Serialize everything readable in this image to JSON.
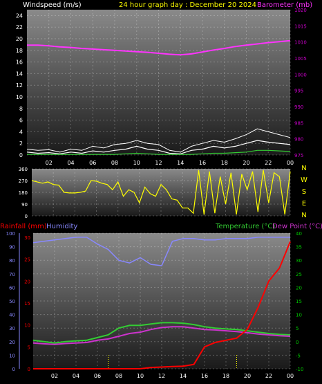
{
  "header": {
    "left_label": "Windspeed (m/s)",
    "center_label": "24 hour graph day : December 20 2024",
    "right_label": "Barometer (mb)"
  },
  "colors": {
    "windspeed": "#ffffff",
    "gust": "#ffffff",
    "avgwind": "#33cc33",
    "barometer": "#ff33ff",
    "direction": "#ffff00",
    "rainfall": "#ff0000",
    "humidity": "#8888ff",
    "temperature": "#33cc33",
    "dewpoint": "#cc33cc",
    "title": "#ffff00",
    "axis_right_top": "#cc00cc",
    "axis_temp": "#00cc00",
    "sunrise": "#ffff00"
  },
  "x_ticks": [
    "02",
    "04",
    "06",
    "08",
    "10",
    "12",
    "14",
    "16",
    "18",
    "20",
    "22",
    "00"
  ],
  "compass": [
    "N",
    "W",
    "S",
    "E",
    "N"
  ],
  "bottom_labels": {
    "rainfall": "Rainfall (mm)",
    "humidity": "Humidity",
    "temperature": "Temperature (°C)",
    "dewpoint": "Dew Point (°C)"
  },
  "chart_data": [
    {
      "type": "line",
      "name": "wind_barometer",
      "x": [
        0,
        1,
        2,
        3,
        4,
        5,
        6,
        7,
        8,
        9,
        10,
        11,
        12,
        13,
        14,
        15,
        16,
        17,
        18,
        19,
        20,
        21,
        22,
        23,
        24
      ],
      "series": [
        {
          "name": "Windspeed (m/s)",
          "axis": "left",
          "values": [
            0.5,
            0.3,
            0.4,
            0.2,
            0.5,
            0.3,
            0.7,
            0.5,
            0.8,
            1.0,
            1.5,
            1.0,
            0.8,
            0.3,
            0.2,
            0.8,
            1.0,
            1.5,
            1.2,
            1.5,
            2.0,
            2.5,
            2.2,
            2.0,
            1.8
          ]
        },
        {
          "name": "Gust",
          "axis": "left",
          "values": [
            1.0,
            0.8,
            0.9,
            0.5,
            1.0,
            0.8,
            1.5,
            1.2,
            1.8,
            2.0,
            2.5,
            2.0,
            1.8,
            0.8,
            0.5,
            1.5,
            2.0,
            2.5,
            2.2,
            2.8,
            3.5,
            4.5,
            4.0,
            3.5,
            3.0
          ]
        },
        {
          "name": "Average",
          "axis": "left",
          "values": [
            0.1,
            0.1,
            0.1,
            0.1,
            0.1,
            0.1,
            0.1,
            0.1,
            0.1,
            0.2,
            0.3,
            0.2,
            0.1,
            0.1,
            0.1,
            0.1,
            0.2,
            0.3,
            0.3,
            0.4,
            0.5,
            0.8,
            0.8,
            0.7,
            0.6
          ]
        },
        {
          "name": "Barometer (mb)",
          "axis": "right",
          "values": [
            1009,
            1009,
            1008.8,
            1008.5,
            1008.3,
            1008,
            1007.8,
            1007.6,
            1007.4,
            1007.2,
            1007,
            1006.8,
            1006.5,
            1006.2,
            1006,
            1006.3,
            1006.9,
            1007.5,
            1008,
            1008.6,
            1009,
            1009.4,
            1009.8,
            1010.1,
            1010.4
          ]
        }
      ],
      "ylim_left": [
        0,
        25
      ],
      "ylim_right": [
        975,
        1020
      ],
      "yticks_left": [
        0,
        2,
        4,
        6,
        8,
        10,
        12,
        14,
        16,
        18,
        20,
        22,
        24
      ],
      "yticks_right": [
        975,
        980,
        985,
        990,
        995,
        1000,
        1005,
        1010,
        1015,
        1020
      ]
    },
    {
      "type": "scatter",
      "name": "wind_direction",
      "x": [
        0,
        0.5,
        1,
        1.5,
        2,
        2.5,
        3,
        3.5,
        4,
        4.5,
        5,
        5.5,
        6,
        6.5,
        7,
        7.5,
        8,
        8.5,
        9,
        9.5,
        10,
        10.5,
        11,
        11.5,
        12,
        12.5,
        13,
        13.5,
        14,
        14.5,
        15,
        15.5,
        16,
        16.5,
        17,
        17.5,
        18,
        18.5,
        19,
        19.5,
        20,
        20.5,
        21,
        21.5,
        22,
        22.5,
        23,
        23.5,
        24
      ],
      "values": [
        270,
        260,
        250,
        260,
        240,
        235,
        180,
        175,
        175,
        180,
        190,
        270,
        265,
        250,
        240,
        200,
        260,
        150,
        200,
        180,
        100,
        220,
        170,
        150,
        240,
        200,
        130,
        120,
        60,
        60,
        20,
        350,
        10,
        340,
        20,
        300,
        90,
        330,
        10,
        320,
        200,
        340,
        30,
        350,
        100,
        330,
        300,
        10,
        340
      ],
      "ylim": [
        0,
        360
      ],
      "yticks": [
        0,
        90,
        180,
        270,
        360
      ]
    },
    {
      "type": "line",
      "name": "rain_humidity_temp",
      "x": [
        0,
        1,
        2,
        3,
        4,
        5,
        6,
        7,
        8,
        9,
        10,
        11,
        12,
        13,
        14,
        15,
        16,
        17,
        18,
        19,
        20,
        21,
        22,
        23,
        24
      ],
      "series": [
        {
          "name": "Rainfall (mm)",
          "axis": "left",
          "values": [
            0,
            0,
            0,
            0,
            0,
            0,
            0,
            0,
            0,
            0,
            0,
            0.3,
            0.4,
            0.5,
            0.6,
            1.0,
            5.0,
            6.0,
            6.5,
            7.0,
            9.0,
            14.0,
            20.0,
            23.0,
            29.0
          ]
        },
        {
          "name": "Humidity",
          "axis": "left",
          "values": [
            93,
            94,
            95,
            96,
            97,
            97,
            92,
            88,
            80,
            78,
            82,
            77,
            76,
            94,
            96,
            96,
            95,
            95,
            96,
            96,
            96,
            97,
            97,
            97,
            97
          ]
        },
        {
          "name": "Temperature (°C)",
          "axis": "right",
          "values": [
            0.5,
            0,
            -0.5,
            0,
            0.3,
            0.5,
            1.5,
            2.5,
            5,
            6,
            6,
            6.5,
            7,
            7,
            6.8,
            6.3,
            5.5,
            5,
            4.7,
            4.5,
            4,
            3.5,
            3,
            2.7,
            2.5
          ]
        },
        {
          "name": "Dew Point (°C)",
          "axis": "right",
          "values": [
            -0.5,
            -0.8,
            -1,
            -0.7,
            -0.5,
            -0.3,
            0.5,
            1,
            2,
            3,
            3.5,
            4.5,
            5.2,
            5.5,
            5.5,
            5,
            4.5,
            4.3,
            4,
            3.7,
            3.3,
            2.8,
            2.5,
            2.2,
            2
          ]
        }
      ],
      "ylim_left": [
        0,
        100
      ],
      "ylim_right": [
        -10,
        40
      ],
      "yticks_humidity": [
        0,
        10,
        20,
        30,
        40,
        50,
        60,
        70,
        80,
        90,
        100
      ],
      "yticks_rain": [
        0,
        5,
        10,
        15,
        20,
        25,
        30
      ],
      "yticks_right": [
        -10,
        -5,
        0,
        5,
        10,
        15,
        20,
        25,
        30,
        35,
        40
      ],
      "markers_x": [
        7,
        19
      ]
    }
  ]
}
